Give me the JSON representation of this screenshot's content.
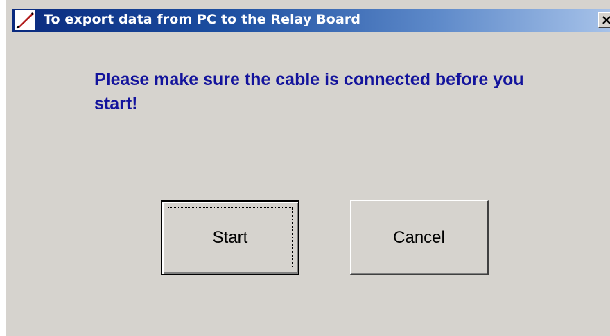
{
  "window": {
    "title": "To export data from PC to the Relay Board",
    "icon": "feather-pen-icon",
    "close_icon": "close-icon"
  },
  "dialog": {
    "message": "Please make sure the cable is connected before you start!",
    "message_color": "#13139c"
  },
  "buttons": {
    "start_label": "Start",
    "cancel_label": "Cancel"
  },
  "colors": {
    "face": "#d6d3ce",
    "title_start": "#0a2a7e",
    "title_end": "#a9c4ea"
  }
}
